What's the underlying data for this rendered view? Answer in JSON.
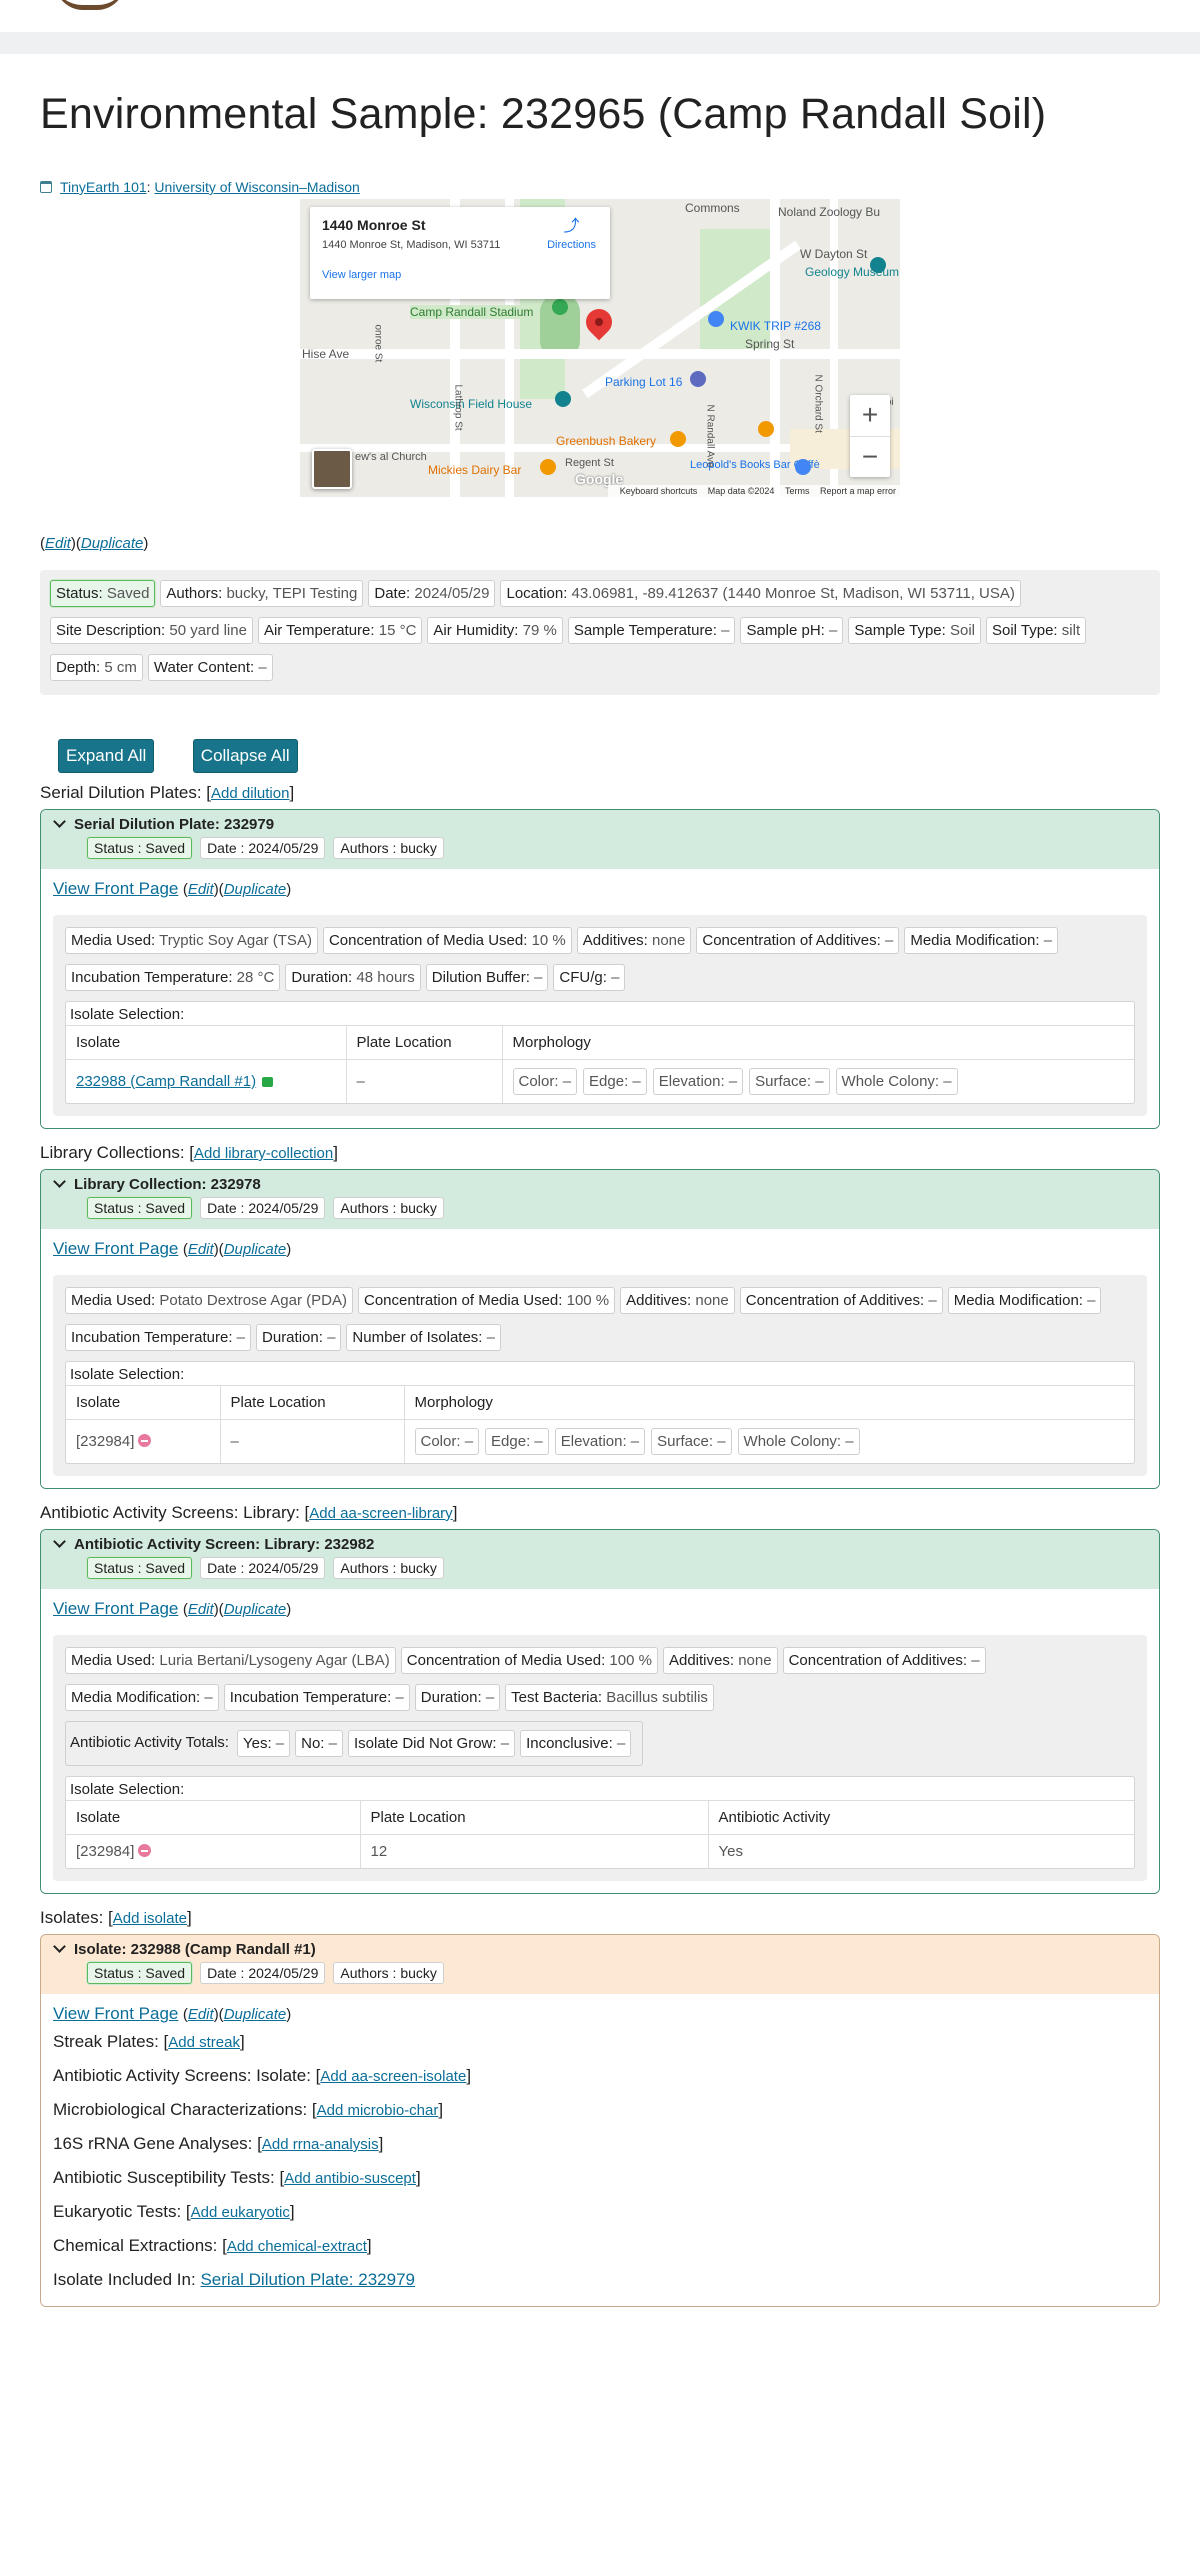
{
  "page": {
    "title": "Environmental Sample: 232965 (Camp Randall Soil)",
    "course": "TinyEarth 101",
    "sep": ":",
    "university": "University of Wisconsin–Madison",
    "edit": "Edit",
    "duplicate": "Duplicate"
  },
  "map": {
    "place_name": "1440 Monroe St",
    "address": "1440 Monroe St, Madison, WI 53711",
    "view_larger": "View larger map",
    "directions": "Directions",
    "labels": {
      "commons": "Commons",
      "noland": "Noland Zoology Bu",
      "dayton": "W Dayton St",
      "geology": "Geology Museum",
      "kwik": "KWIK TRIP #268",
      "spring": "Spring St",
      "camp_randall": "Camp Randall Stadium",
      "hise": "Hise Ave",
      "parking": "Parking Lot 16",
      "field_house": "Wisconsin Field House",
      "greenbush": "Greenbush Bakery",
      "mickies": "Mickies Dairy Bar",
      "regent": "Regent St",
      "leopold": "Leopold's Books Bar Caffè",
      "church": "ew's al Church",
      "n_randall": "N Randall Ave",
      "n_orchard": "N Orchard St",
      "capi": "Capi",
      "lathrop": "Lathrop St",
      "monroe": "onroe St"
    },
    "google": "Google",
    "attrib": {
      "shortcuts": "Keyboard shortcuts",
      "data": "Map data ©2024",
      "terms": "Terms",
      "report": "Report a map error"
    },
    "zoom_in": "+",
    "zoom_out": "−"
  },
  "sample": {
    "status": {
      "k": "Status:",
      "v": "Saved"
    },
    "authors": {
      "k": "Authors:",
      "v": "bucky, TEPI Testing"
    },
    "date": {
      "k": "Date:",
      "v": "2024/05/29"
    },
    "location": {
      "k": "Location:",
      "v": "43.06981, -89.412637 (1440 Monroe St, Madison, WI 53711, USA)"
    },
    "site": {
      "k": "Site Description:",
      "v": "50 yard line"
    },
    "air_temp": {
      "k": "Air Temperature:",
      "v": "15 °C"
    },
    "air_hum": {
      "k": "Air Humidity:",
      "v": "79 %"
    },
    "sample_temp": {
      "k": "Sample Temperature:",
      "v": "–"
    },
    "ph": {
      "k": "Sample pH:",
      "v": "–"
    },
    "type": {
      "k": "Sample Type:",
      "v": "Soil"
    },
    "soil_type": {
      "k": "Soil Type:",
      "v": "silt"
    },
    "depth": {
      "k": "Depth:",
      "v": "5 cm"
    },
    "water": {
      "k": "Water Content:",
      "v": "–"
    }
  },
  "buttons": {
    "expand": "Expand All",
    "collapse": "Collapse All"
  },
  "common": {
    "status_lbl": "Status : ",
    "saved": "Saved",
    "date_lbl": "Date : ",
    "date_val": "2024/05/29",
    "authors_lbl": "Authors : ",
    "authors_val": "bucky",
    "view_front": "View Front Page",
    "edit": "Edit",
    "duplicate": "Duplicate",
    "isolate_selection": "Isolate Selection:",
    "col_isolate": "Isolate",
    "col_plate": "Plate Location",
    "col_morph": "Morphology",
    "col_activity": "Antibiotic Activity",
    "dash": "–",
    "morph": {
      "color": "Color:",
      "edge": "Edge:",
      "elevation": "Elevation:",
      "surface": "Surface:",
      "whole": "Whole Colony:"
    }
  },
  "serial": {
    "section": "Serial Dilution Plates:",
    "add": "Add dilution",
    "title": "Serial Dilution Plate: 232979",
    "media": {
      "k": "Media Used:",
      "v": "Tryptic Soy Agar (TSA)"
    },
    "conc": {
      "k": "Concentration of Media Used:",
      "v": "10 %"
    },
    "additives": {
      "k": "Additives:",
      "v": "none"
    },
    "conc_add": {
      "k": "Concentration of Additives:",
      "v": "–"
    },
    "mod": {
      "k": "Media Modification:",
      "v": "–"
    },
    "incub": {
      "k": "Incubation Temperature:",
      "v": "28 °C"
    },
    "duration": {
      "k": "Duration:",
      "v": "48 hours"
    },
    "buffer": {
      "k": "Dilution Buffer:",
      "v": "–"
    },
    "cfu": {
      "k": "CFU/g:",
      "v": "–"
    },
    "row": {
      "isolate": "232988 (Camp Randall #1)",
      "plate": "–"
    }
  },
  "library": {
    "section": "Library Collections:",
    "add": "Add library-collection",
    "title": "Library Collection: 232978",
    "media": {
      "k": "Media Used:",
      "v": "Potato Dextrose Agar (PDA)"
    },
    "conc": {
      "k": "Concentration of Media Used:",
      "v": "100 %"
    },
    "additives": {
      "k": "Additives:",
      "v": "none"
    },
    "conc_add": {
      "k": "Concentration of Additives:",
      "v": "–"
    },
    "mod": {
      "k": "Media Modification:",
      "v": "–"
    },
    "incub": {
      "k": "Incubation Temperature:",
      "v": "–"
    },
    "duration": {
      "k": "Duration:",
      "v": "–"
    },
    "num": {
      "k": "Number of Isolates:",
      "v": "–"
    },
    "row": {
      "isolate": "[232984]",
      "plate": "–"
    }
  },
  "aa": {
    "section": "Antibiotic Activity Screens: Library:",
    "add": "Add aa-screen-library",
    "title": "Antibiotic Activity Screen: Library: 232982",
    "media": {
      "k": "Media Used:",
      "v": "Luria Bertani/Lysogeny Agar (LBA)"
    },
    "conc": {
      "k": "Concentration of Media Used:",
      "v": "100 %"
    },
    "additives": {
      "k": "Additives:",
      "v": "none"
    },
    "conc_add": {
      "k": "Concentration of Additives:",
      "v": "–"
    },
    "mod": {
      "k": "Media Modification:",
      "v": "–"
    },
    "incub": {
      "k": "Incubation Temperature:",
      "v": "–"
    },
    "duration": {
      "k": "Duration:",
      "v": "–"
    },
    "bacteria": {
      "k": "Test Bacteria:",
      "v": "Bacillus subtilis"
    },
    "totals_lbl": "Antibiotic Activity Totals:",
    "yes": {
      "k": "Yes:",
      "v": "–"
    },
    "no": {
      "k": "No:",
      "v": "–"
    },
    "nogrow": {
      "k": "Isolate Did Not Grow:",
      "v": "–"
    },
    "inconc": {
      "k": "Inconclusive:",
      "v": "–"
    },
    "row": {
      "isolate": "[232984]",
      "plate": "12",
      "activity": "Yes"
    }
  },
  "isolates": {
    "section": "Isolates:",
    "add": "Add isolate",
    "title": "Isolate: 232988 (Camp Randall #1)",
    "streak": "Streak Plates:",
    "streak_add": "Add streak",
    "aas": "Antibiotic Activity Screens: Isolate:",
    "aas_add": "Add aa-screen-isolate",
    "micro": "Microbiological Characterizations:",
    "micro_add": "Add microbio-char",
    "rrna": "16S rRNA Gene Analyses:",
    "rrna_add": "Add rrna-analysis",
    "susc": "Antibiotic Susceptibility Tests:",
    "susc_add": "Add antibio-suscept",
    "euk": "Eukaryotic Tests:",
    "euk_add": "Add eukaryotic",
    "chem": "Chemical Extractions:",
    "chem_add": "Add chemical-extract",
    "included": "Isolate Included In:",
    "included_link": "Serial Dilution Plate: 232979"
  }
}
